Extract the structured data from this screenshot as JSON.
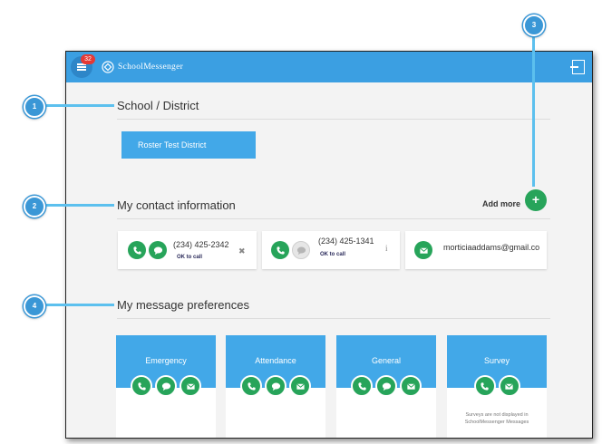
{
  "header": {
    "notification_count": "32",
    "brand": "SchoolMessenger"
  },
  "school": {
    "title": "School / District",
    "district_name": "Roster Test District"
  },
  "contact": {
    "title": "My contact information",
    "add_more_label": "Add more",
    "add_button": "+",
    "items": [
      {
        "number": "(234) 425-2342",
        "status": "OK to call",
        "action_icon": "close-icon",
        "action_glyph": "✖"
      },
      {
        "number": "(234) 425-1341",
        "status": "OK to call",
        "action_icon": "info-icon",
        "action_glyph": "i"
      },
      {
        "email": "morticiaaddams@gmail.co"
      }
    ]
  },
  "preferences": {
    "title": "My message preferences",
    "items": [
      {
        "label": "Emergency",
        "icons": [
          "phone-icon",
          "chat-icon",
          "email-icon"
        ]
      },
      {
        "label": "Attendance",
        "icons": [
          "phone-icon",
          "chat-icon",
          "email-icon"
        ]
      },
      {
        "label": "General",
        "icons": [
          "phone-icon",
          "chat-icon",
          "email-icon"
        ]
      },
      {
        "label": "Survey",
        "icons": [
          "phone-icon",
          "email-icon"
        ],
        "note": "Surveys are not displayed in SchoolMessenger Messages"
      }
    ]
  },
  "callouts": [
    "1",
    "2",
    "3",
    "4"
  ],
  "colors": {
    "header_blue": "#3b9fe2",
    "tile_blue": "#42a8e8",
    "green": "#27a45a",
    "callout": "#3a97d6",
    "badge_red": "#e53935"
  }
}
